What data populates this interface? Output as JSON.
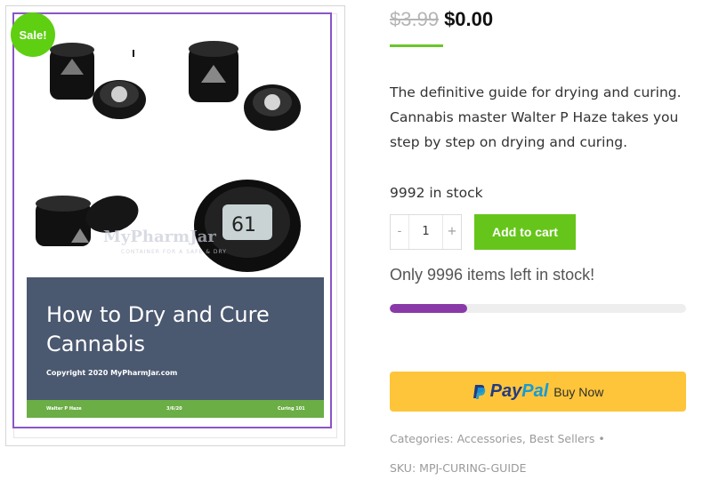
{
  "badge": {
    "sale": "Sale!"
  },
  "book": {
    "title": "How to Dry and Cure Cannabis",
    "copyright": "Copyright 2020 MyPharmJar.com",
    "watermark": "MyPharmJar",
    "watermark_sub": "CONTAINER FOR A SAFE & DRY",
    "footer_left": "Walter P Haze",
    "footer_center": "3/6/20",
    "footer_right": "Curing 101"
  },
  "price": {
    "regular": "$3.99",
    "sale": "$0.00"
  },
  "description": "The definitive guide for drying and curing. Cannabis master Walter P Haze takes you step by step on drying and curing.",
  "stock_text": "9992 in stock",
  "quantity": {
    "minus": "-",
    "value": "1",
    "plus": "+"
  },
  "add_to_cart": "Add to cart",
  "stock_notice": "Only 9996 items left in stock!",
  "stock_progress": 0.26,
  "paypal": {
    "pay": "Pay",
    "pal": "Pal",
    "buy_now": "Buy Now"
  },
  "meta": {
    "categories_label": "Categories:",
    "categories": [
      "Accessories",
      "Best Sellers"
    ],
    "separator": "•",
    "sku_label": "SKU:",
    "sku": "MPJ-CURING-GUIDE"
  },
  "colors": {
    "accent_green": "#66c51a",
    "sale_badge": "#5fcf12",
    "progress_purple": "#8a3aa8",
    "paypal_yellow": "#fec53a",
    "book_border": "#8a55c8"
  }
}
